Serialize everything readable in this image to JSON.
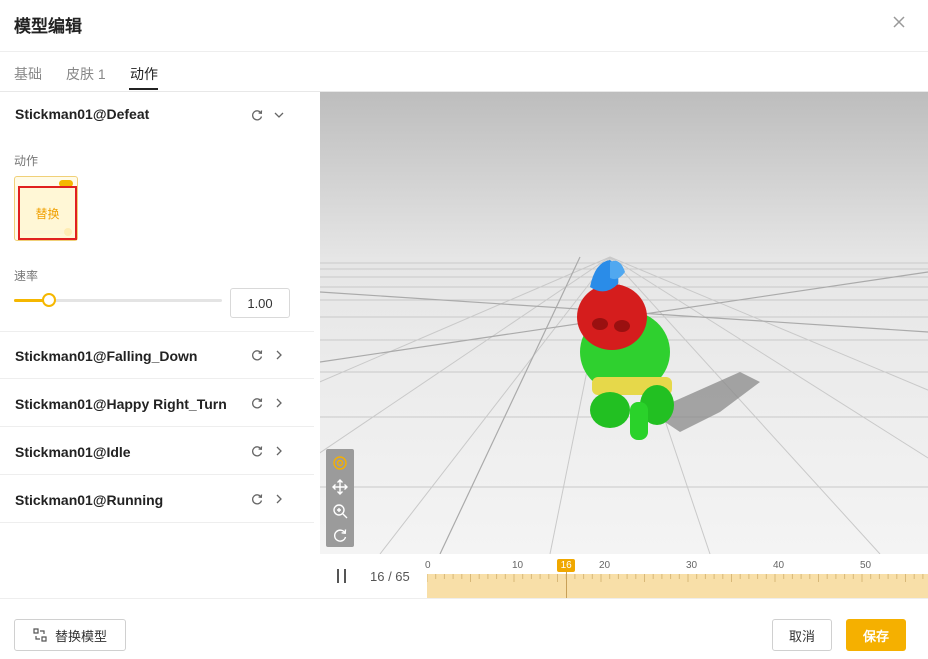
{
  "dialog": {
    "title": "模型编辑"
  },
  "tabs": [
    {
      "label": "基础",
      "active": false
    },
    {
      "label": "皮肤 1",
      "active": false
    },
    {
      "label": "动作",
      "active": true
    }
  ],
  "animations": [
    {
      "name": "Stickman01@Defeat",
      "expanded": true
    },
    {
      "name": "Stickman01@Falling_Down",
      "expanded": false
    },
    {
      "name": "Stickman01@Happy Right_Turn",
      "expanded": false
    },
    {
      "name": "Stickman01@Idle",
      "expanded": false
    },
    {
      "name": "Stickman01@Running",
      "expanded": false
    }
  ],
  "detail": {
    "action_label": "动作",
    "replace_label": "替换",
    "rate_label": "速率",
    "rate_value": "1.00",
    "rate_fraction": 0.17
  },
  "viewport_tools": [
    "target-icon",
    "move-icon",
    "zoom-in-icon",
    "rotate-icon"
  ],
  "timeline": {
    "frame_display": "16 / 65",
    "current_frame": "16",
    "total_frames": 65,
    "ticks": [
      "0",
      "10",
      "20",
      "30",
      "40",
      "50"
    ]
  },
  "footer": {
    "replace_model_label": "替换模型",
    "cancel_label": "取消",
    "save_label": "保存"
  },
  "colors": {
    "accent": "#f5b000",
    "highlight_border": "#e02020",
    "timeline_fill": "#f8dfa8"
  }
}
